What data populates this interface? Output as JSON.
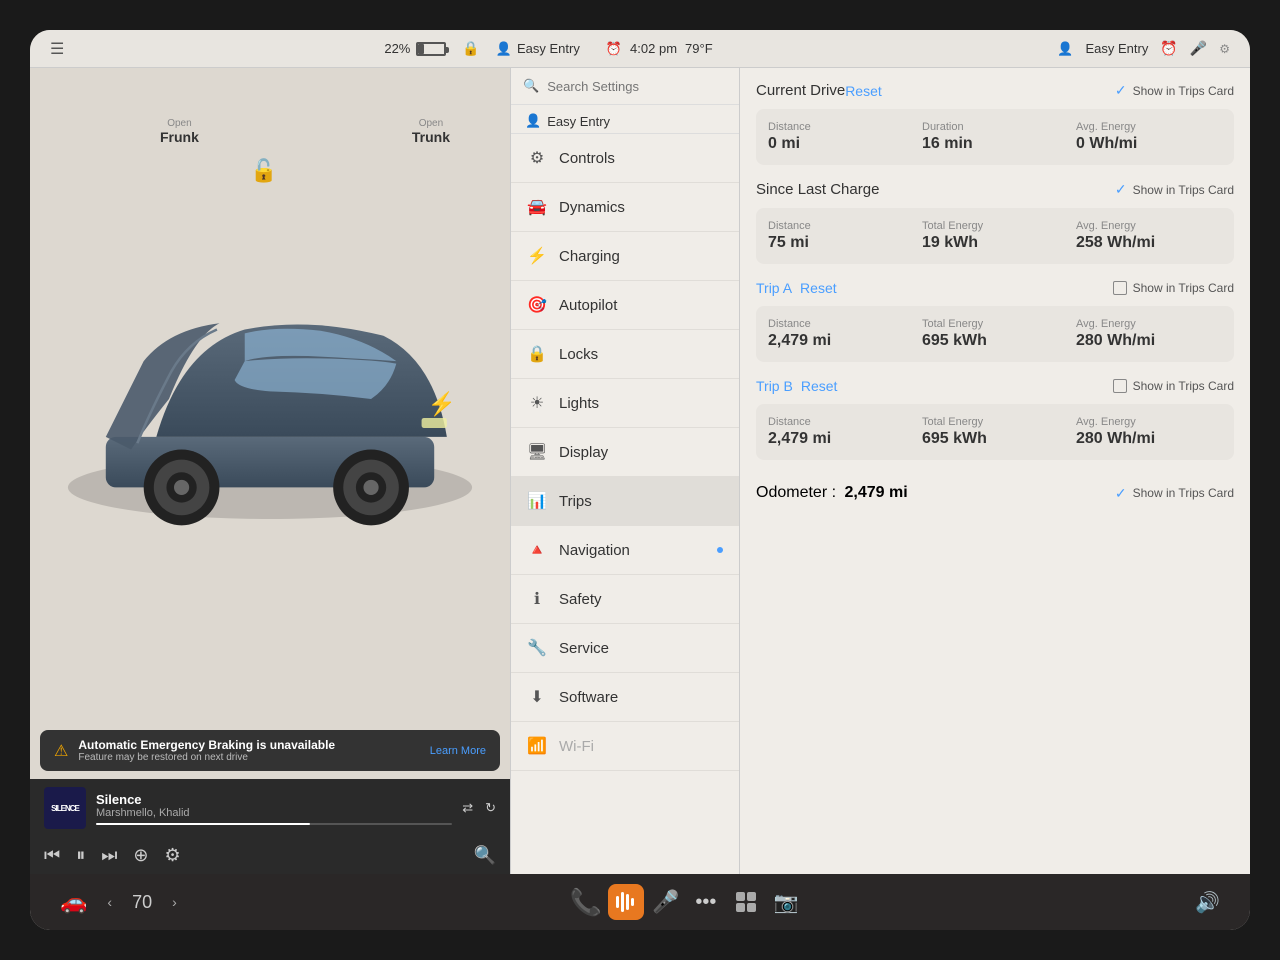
{
  "statusBar": {
    "battery": "22%",
    "time": "4:02 pm",
    "temperature": "79°F",
    "profile": "Easy Entry",
    "profileTopRight": "Easy Entry"
  },
  "carView": {
    "frunk": {
      "label": "Open",
      "value": "Frunk"
    },
    "trunk": {
      "label": "Open",
      "value": "Trunk"
    }
  },
  "alert": {
    "title": "Automatic Emergency Braking is unavailable",
    "subtitle": "Feature may be restored on next drive",
    "action": "Learn More"
  },
  "music": {
    "title": "Silence",
    "artist": "Marshmello, Khalid",
    "albumArt": "SILENCE"
  },
  "settingsMenu": {
    "searchPlaceholder": "Search Settings",
    "items": [
      {
        "icon": "⚙",
        "label": "Controls"
      },
      {
        "icon": "🚗",
        "label": "Dynamics"
      },
      {
        "icon": "⚡",
        "label": "Charging"
      },
      {
        "icon": "🤖",
        "label": "Autopilot"
      },
      {
        "icon": "🔒",
        "label": "Locks"
      },
      {
        "icon": "💡",
        "label": "Lights"
      },
      {
        "icon": "🖥",
        "label": "Display"
      },
      {
        "icon": "📊",
        "label": "Trips",
        "active": true
      },
      {
        "icon": "🔺",
        "label": "Navigation",
        "dot": true
      },
      {
        "icon": "ℹ",
        "label": "Safety"
      },
      {
        "icon": "🔧",
        "label": "Service"
      },
      {
        "icon": "⬇",
        "label": "Software"
      },
      {
        "icon": "📶",
        "label": "Wi-Fi",
        "dim": true
      }
    ]
  },
  "trips": {
    "currentDrive": {
      "title": "Current Drive",
      "resetLabel": "Reset",
      "showInTrips": true,
      "distance": {
        "label": "Distance",
        "value": "0 mi"
      },
      "duration": {
        "label": "Duration",
        "value": "16 min"
      },
      "avgEnergy": {
        "label": "Avg. Energy",
        "value": "0 Wh/mi"
      }
    },
    "sinceLastCharge": {
      "title": "Since Last Charge",
      "showInTrips": true,
      "distance": {
        "label": "Distance",
        "value": "75 mi"
      },
      "totalEnergy": {
        "label": "Total Energy",
        "value": "19 kWh"
      },
      "avgEnergy": {
        "label": "Avg. Energy",
        "value": "258 Wh/mi"
      }
    },
    "tripA": {
      "title": "Trip A",
      "resetLabel": "Reset",
      "showInTrips": false,
      "distance": {
        "label": "Distance",
        "value": "2,479 mi"
      },
      "totalEnergy": {
        "label": "Total Energy",
        "value": "695 kWh"
      },
      "avgEnergy": {
        "label": "Avg. Energy",
        "value": "280 Wh/mi"
      }
    },
    "tripB": {
      "title": "Trip B",
      "resetLabel": "Reset",
      "showInTrips": false,
      "distance": {
        "label": "Distance",
        "value": "2,479 mi"
      },
      "totalEnergy": {
        "label": "Total Energy",
        "value": "695 kWh"
      },
      "avgEnergy": {
        "label": "Avg. Energy",
        "value": "280 Wh/mi"
      }
    },
    "odometer": {
      "label": "Odometer :",
      "value": "2,479 mi",
      "showInTrips": true
    }
  },
  "taskbar": {
    "temperature": "70",
    "volumeIcon": "🔊",
    "phoneIcon": "📞",
    "voiceIcon": "🎤",
    "micIcon": "●",
    "dotsIcon": "•••",
    "gridIcon": "⊞",
    "cameraIcon": "📷",
    "carIcon": "🚗"
  }
}
